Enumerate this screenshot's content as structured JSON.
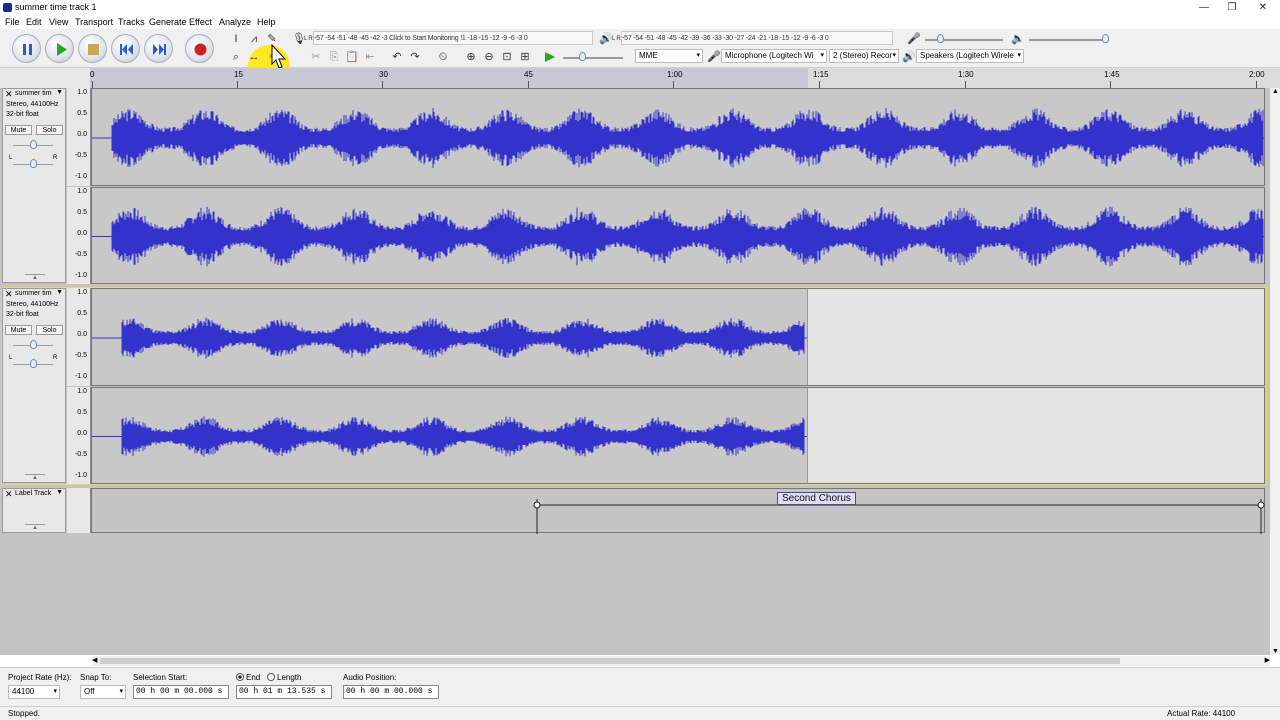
{
  "window": {
    "title": "summer time track 1",
    "controls": {
      "minimize": "—",
      "maximize": "❐",
      "close": "✕"
    }
  },
  "menu": [
    "File",
    "Edit",
    "View",
    "Transport",
    "Tracks",
    "Generate",
    "Effect",
    "Analyze",
    "Help"
  ],
  "transport": {
    "buttons": [
      "pause",
      "play",
      "stop",
      "skip-to-start",
      "skip-to-end",
      "record"
    ]
  },
  "meters": {
    "record_meter_text": "-57 -54 -51 -48 -45 -42 -3 Click to Start Monitoring !1 -18 -15 -12 -9 -6 -3 0",
    "record_meter_label": "L R",
    "play_meter_text": "-57 -54 -51 -48 -45 -42 -39 -36 -33 -30 -27 -24 -21 -18 -15 -12 -9 -6 -3 0",
    "play_meter_label": "L R"
  },
  "devices": {
    "host": "MME",
    "recording_device": "Microphone (Logitech Wi",
    "channels": "2 (Stereo) Recor",
    "playback_device": "Speakers (Logitech Wirele"
  },
  "ruler": {
    "ticks": [
      "0",
      "15",
      "30",
      "45",
      "1:00",
      "1:15",
      "1:30",
      "1:45",
      "2:00"
    ]
  },
  "tracks": [
    {
      "name": "summer tim",
      "format": "Stereo, 44100Hz",
      "bits": "32-bit float",
      "mute": "Mute",
      "solo": "Solo",
      "gain_left": "L",
      "gain_right": "R",
      "scale": [
        "1.0",
        "0.5",
        "0.0",
        "-0.5",
        "-1.0"
      ]
    },
    {
      "name": "summer tim",
      "format": "Stereo, 44100Hz",
      "bits": "32-bit float",
      "mute": "Mute",
      "solo": "Solo",
      "gain_left": "L",
      "gain_right": "R",
      "scale": [
        "1.0",
        "0.5",
        "0.0",
        "-0.5",
        "-1.0"
      ]
    }
  ],
  "label_track": {
    "name": "Label Track",
    "label_text": "Second Chorus"
  },
  "selection_bar": {
    "project_rate_label": "Project Rate (Hz):",
    "project_rate": "44100",
    "snap_label": "Snap To:",
    "snap_value": "Off",
    "selection_start_label": "Selection Start:",
    "selection_start": "00 h 00 m 00.000 s",
    "end_label": "End",
    "length_label": "Length",
    "end_value": "00 h 01 m 13.535 s",
    "audio_position_label": "Audio Position:",
    "audio_position": "00 h 00 m 00.000 s"
  },
  "status": {
    "state": "Stopped.",
    "actual_rate": "Actual Rate: 44100"
  },
  "colors": {
    "waveform": "#3333cc",
    "highlight": "#ffe600",
    "record": "#cc2222",
    "play": "#22aa22"
  }
}
